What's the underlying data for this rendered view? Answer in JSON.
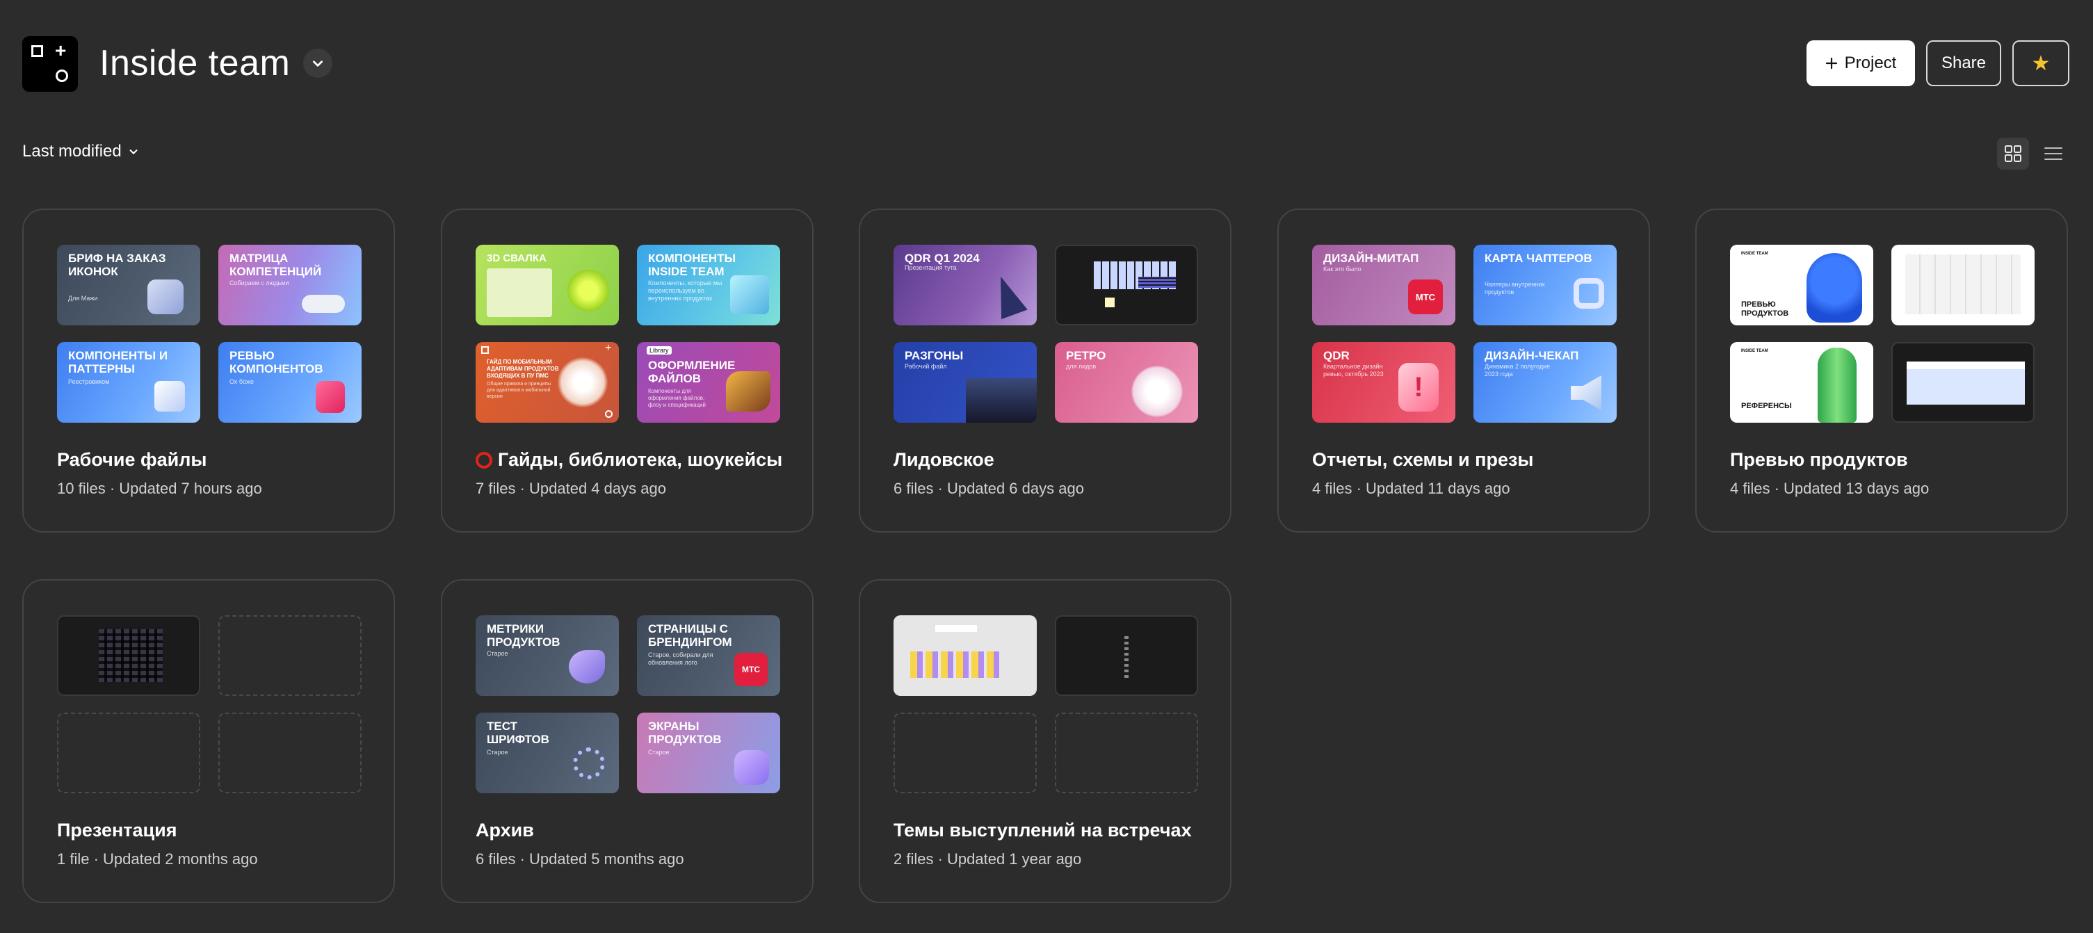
{
  "header": {
    "title": "Inside team",
    "project_button": "Project",
    "share_button": "Share"
  },
  "toolbar": {
    "sort_label": "Last modified"
  },
  "projects": [
    {
      "name": "Рабочие файлы",
      "meta": "10 files · Updated 7 hours ago",
      "thumbs": [
        {
          "title": "Бриф на заказ иконок",
          "subtitle": "Для Мажи"
        },
        {
          "title": "Матрица компетенций",
          "subtitle": "Собираем с людьми"
        },
        {
          "title": "Компоненты и паттерны",
          "subtitle": "Реестровиком"
        },
        {
          "title": "Ревью компонентов",
          "subtitle": "Ох боже"
        }
      ]
    },
    {
      "name": "Гайды, библиотека, шоукейсы",
      "meta": "7 files · Updated 4 days ago",
      "thumbs": [
        {
          "title": "3D свалка",
          "subtitle": ""
        },
        {
          "title": "Компоненты Inside Team",
          "subtitle": "Компоненты, которые мы переиспользуем во внутренних продуктах"
        },
        {
          "title": "Гайд по мобильным адаптивам продуктов входящих в ПУ ПМС",
          "subtitle": "Общие правила и принципы для адаптивов в мобильной версии"
        },
        {
          "title": "Оформление файлов",
          "subtitle": "Компоненты для оформления файлов, флоу и спецификаций",
          "badge": "Library"
        }
      ]
    },
    {
      "name": "Лидовское",
      "meta": "6 files · Updated 6 days ago",
      "thumbs": [
        {
          "title": "QDR Q1 2024",
          "subtitle": "Презентация тута"
        },
        {
          "title": "",
          "subtitle": ""
        },
        {
          "title": "Разгоны",
          "subtitle": "Рабочий файл"
        },
        {
          "title": "Ретро",
          "subtitle": "для лидов"
        }
      ]
    },
    {
      "name": "Отчеты, схемы и презы",
      "meta": "4 files · Updated 11 days ago",
      "thumbs": [
        {
          "title": "Дизайн-митап",
          "subtitle": "Как это было"
        },
        {
          "title": "Карта чаптеров",
          "subtitle": "Чаптеры внутренних продуктов"
        },
        {
          "title": "QDR",
          "subtitle": "Квартальное дизайн ревью, октябрь 2023"
        },
        {
          "title": "Дизайн-чекап",
          "subtitle": "Динамика 2 полугодие 2023 года"
        }
      ]
    },
    {
      "name": "Превью продуктов",
      "meta": "4 files · Updated 13 days ago",
      "thumbs": [
        {
          "title": "Превью продуктов",
          "subtitle": "",
          "brand": "INSIDE TEAM"
        },
        {
          "title": "",
          "subtitle": ""
        },
        {
          "title": "Референсы",
          "subtitle": "",
          "brand": "INSIDE TEAM"
        },
        {
          "title": "",
          "subtitle": ""
        }
      ]
    },
    {
      "name": "Презентация",
      "meta": "1 file · Updated 2 months ago",
      "thumbs": [
        {
          "title": "",
          "subtitle": ""
        }
      ]
    },
    {
      "name": "Архив",
      "meta": "6 files · Updated 5 months ago",
      "thumbs": [
        {
          "title": "Метрики продуктов",
          "subtitle": "Старое"
        },
        {
          "title": "Страницы с брендингом",
          "subtitle": "Старое, собирали для обновления лого"
        },
        {
          "title": "Тест шрифтов",
          "subtitle": "Старое"
        },
        {
          "title": "Экраны продуктов",
          "subtitle": "Старое"
        }
      ]
    },
    {
      "name": "Темы выступлений на встречах",
      "meta": "2 files · Updated 1 year ago",
      "thumbs": [
        {
          "title": "",
          "subtitle": ""
        },
        {
          "title": "",
          "subtitle": ""
        }
      ]
    }
  ],
  "colors": {
    "background": "#2c2c2c",
    "card_border": "#444444",
    "star": "#f4c430",
    "status_ring": "#e2231a"
  },
  "icons": {
    "logo": "inside-team-logo",
    "title_dropdown": "chevron-down-icon",
    "project_button": "plus-icon",
    "favorite_button": "star-icon",
    "sort": "chevron-down-icon",
    "grid_view": "grid-view-icon",
    "list_view": "list-view-icon",
    "project_status": "red-ring-icon"
  }
}
